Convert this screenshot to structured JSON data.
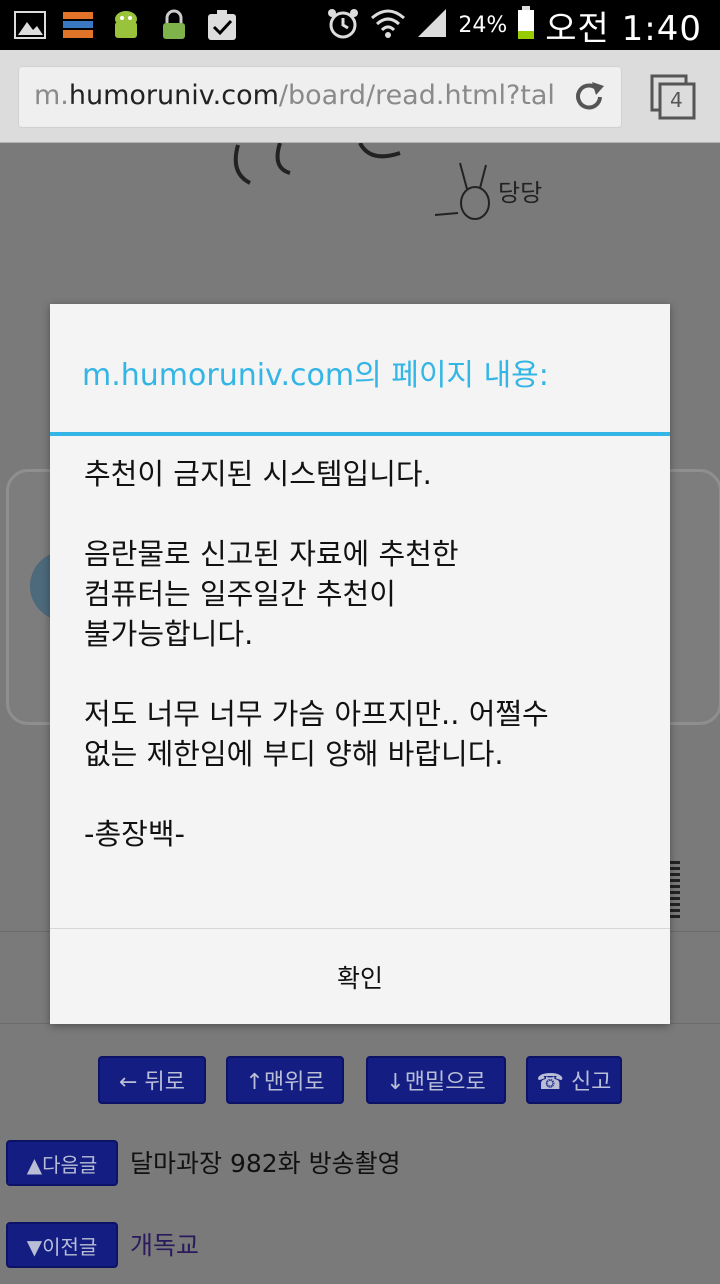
{
  "status_bar": {
    "battery_percent": "24%",
    "time": "오전 1:40",
    "icons": [
      "image-icon",
      "app-icon",
      "android-icon",
      "lock-icon",
      "check-icon",
      "alarm-icon",
      "wifi-icon",
      "signal-icon",
      "battery-icon"
    ]
  },
  "browser": {
    "url_prefix": "m.",
    "url_host": "humoruniv.com",
    "url_path": "/board/read.html?tal",
    "tab_count": "4"
  },
  "dialog": {
    "title": "m.humoruniv.com의 페이지 내용:",
    "line1": "추천이 금지된 시스템입니다.",
    "line2": "음란물로 신고된 자료에 추천한",
    "line3": "컴퓨터는 일주일간 추천이",
    "line4": "불가능합니다.",
    "line5": "저도 너무 너무 가슴 아프지만.. 어쩔수",
    "line6": "없는 제한임에 부디 양해 바랍니다.",
    "signature": "-총장백-",
    "ok_label": "확인",
    "accent_color": "#33b5e5"
  },
  "page": {
    "doodle_text": "당당",
    "nav": {
      "back": "← 뒤로",
      "top": "↑맨위로",
      "bottom": "↓맨밑으로",
      "report": "☎ 신고"
    },
    "next_post": {
      "tag": "▲다음글",
      "title": "달마과장 982화 방송촬영"
    },
    "prev_post": {
      "tag": "▼이전글",
      "title": "개독교"
    }
  }
}
